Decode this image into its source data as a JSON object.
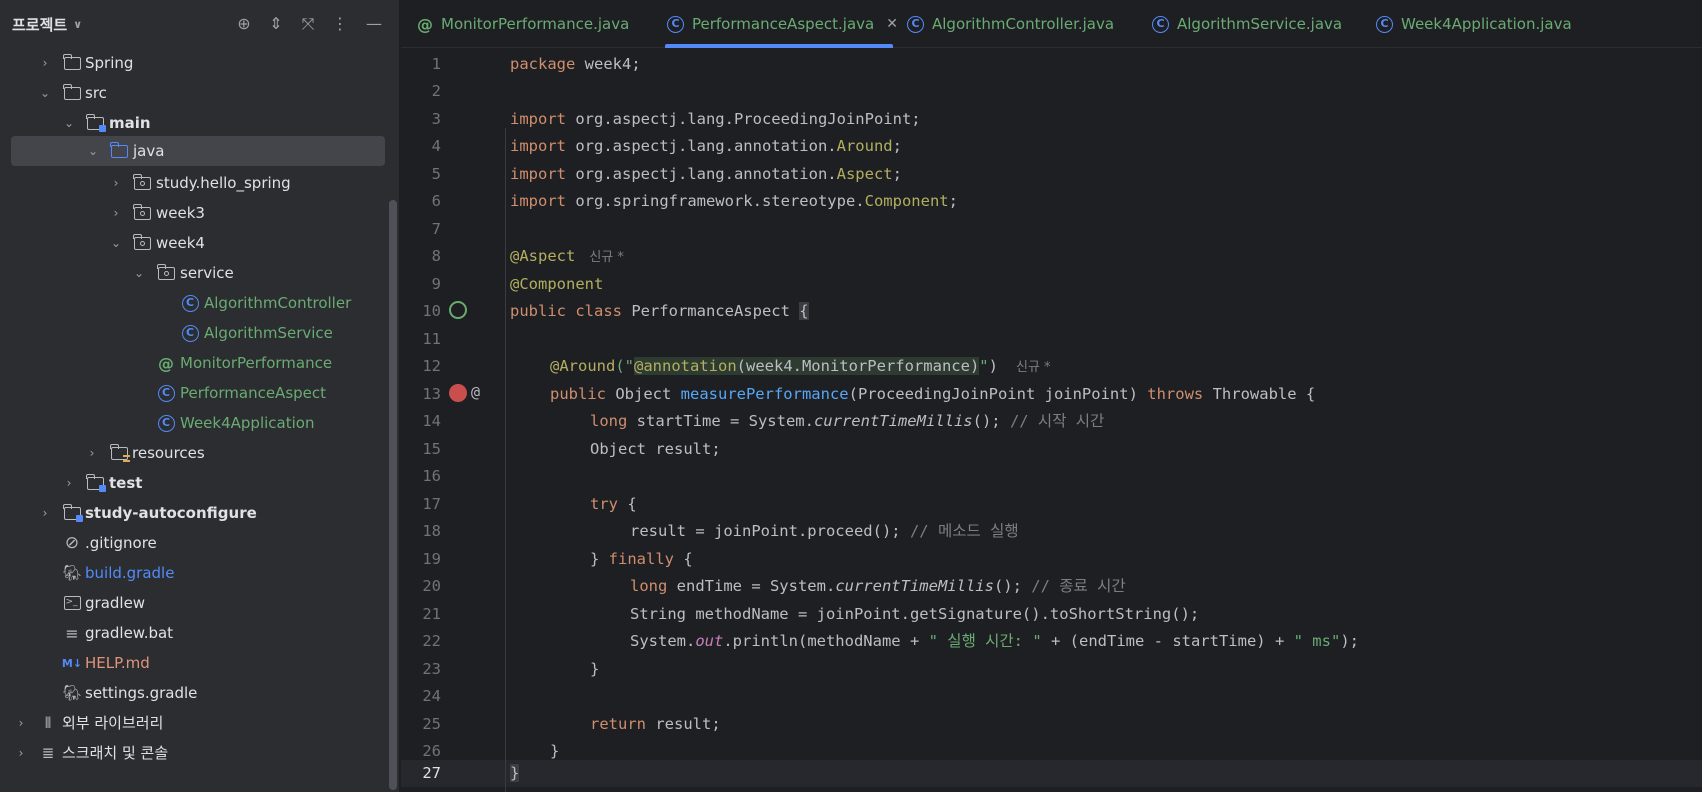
{
  "project": {
    "title": "프로젝트",
    "tree": [
      {
        "label": "Spring",
        "icon": "folder-icon"
      },
      {
        "label": "src",
        "icon": "folder-icon"
      },
      {
        "label": "main",
        "icon": "source-folder-icon"
      },
      {
        "label": "java",
        "icon": "source-root-icon"
      },
      {
        "label": "study.hello_spring",
        "icon": "package-icon"
      },
      {
        "label": "week3",
        "icon": "package-icon"
      },
      {
        "label": "week4",
        "icon": "package-icon"
      },
      {
        "label": "service",
        "icon": "package-icon"
      },
      {
        "label": "AlgorithmController",
        "icon": "class-icon"
      },
      {
        "label": "AlgorithmService",
        "icon": "class-icon"
      },
      {
        "label": "MonitorPerformance",
        "icon": "annotation-icon"
      },
      {
        "label": "PerformanceAspect",
        "icon": "class-icon"
      },
      {
        "label": "Week4Application",
        "icon": "spring-boot-class-icon"
      },
      {
        "label": "resources",
        "icon": "resources-folder-icon"
      },
      {
        "label": "test",
        "icon": "test-folder-icon"
      },
      {
        "label": "study-autoconfigure",
        "icon": "module-folder-icon"
      },
      {
        "label": ".gitignore",
        "icon": "ignore-file-icon"
      },
      {
        "label": "build.gradle",
        "icon": "gradle-icon"
      },
      {
        "label": "gradlew",
        "icon": "shell-icon"
      },
      {
        "label": "gradlew.bat",
        "icon": "text-file-icon"
      },
      {
        "label": "HELP.md",
        "icon": "markdown-icon"
      },
      {
        "label": "settings.gradle",
        "icon": "gradle-icon"
      },
      {
        "label": "외부 라이브러리",
        "icon": "library-icon"
      },
      {
        "label": "스크래치 및 콘솔",
        "icon": "scratches-icon"
      }
    ]
  },
  "tabs": [
    {
      "label": "MonitorPerformance.java",
      "icon": "annotation-icon"
    },
    {
      "label": "PerformanceAspect.java",
      "icon": "class-icon",
      "active": true
    },
    {
      "label": "AlgorithmController.java",
      "icon": "class-icon"
    },
    {
      "label": "AlgorithmService.java",
      "icon": "class-icon"
    },
    {
      "label": "Week4Application.java",
      "icon": "spring-boot-class-icon"
    }
  ],
  "editor": {
    "line_numbers": [
      "1",
      "2",
      "3",
      "4",
      "5",
      "6",
      "7",
      "8",
      "9",
      "10",
      "11",
      "12",
      "13",
      "14",
      "15",
      "16",
      "17",
      "18",
      "19",
      "20",
      "21",
      "22",
      "23",
      "24",
      "25",
      "26",
      "27"
    ],
    "inlay_new": "신규 *",
    "code": {
      "l1a": "package",
      "l1b": " week4;",
      "l3a": "import",
      "l3b": " org.aspectj.lang.ProceedingJoinPoint;",
      "l4a": "import",
      "l4b": " org.aspectj.lang.annotation.",
      "l4c": "Around",
      "l4d": ";",
      "l5a": "import",
      "l5b": " org.aspectj.lang.annotation.",
      "l5c": "Aspect",
      "l5d": ";",
      "l6a": "import",
      "l6b": " org.springframework.stereotype.",
      "l6c": "Component",
      "l6d": ";",
      "l8a": "@Aspect",
      "l9a": "@Component",
      "l10a": "public class",
      "l10b": " PerformanceAspect ",
      "l10c": "{",
      "l12a": "@Around",
      "l12b": "(\"",
      "l12c": "@annotation",
      "l12d": "(week4.MonitorPerformance)",
      "l12e": "\"",
      ")": ")",
      "l13a": "public",
      "l13b": " Object ",
      "l13c": "measurePerformance",
      "l13d": "(ProceedingJoinPoint joinPoint) ",
      "l13e": "throws",
      "l13f": " Throwable {",
      "l14a": "long",
      "l14b": " startTime = System.",
      "l14c": "currentTimeMillis",
      "l14d": "(); ",
      "l14e": "// 시작 시간",
      "l15a": "Object result;",
      "l17a": "try",
      "l17b": " {",
      "l18a": "result = joinPoint.proceed(); ",
      "l18b": "// 메소드 실행",
      "l19a": "} ",
      "l19b": "finally",
      "l19c": " {",
      "l20a": "long",
      "l20b": " endTime = System.",
      "l20c": "currentTimeMillis",
      "l20d": "(); ",
      "l20e": "// 종료 시간",
      "l21a": "String methodName = joinPoint.getSignature().toShortString();",
      "l22a": "System.",
      "l22b": "out",
      "l22c": ".println(methodName + ",
      "l22d": "\" 실행 시간: \"",
      "l22e": " + (endTime - startTime) + ",
      "l22f": "\" ms\"",
      "l22g": ");",
      "l23a": "}",
      "l25a": "return",
      "l25b": " result;",
      "l26a": "}",
      "l27a": "}"
    }
  }
}
